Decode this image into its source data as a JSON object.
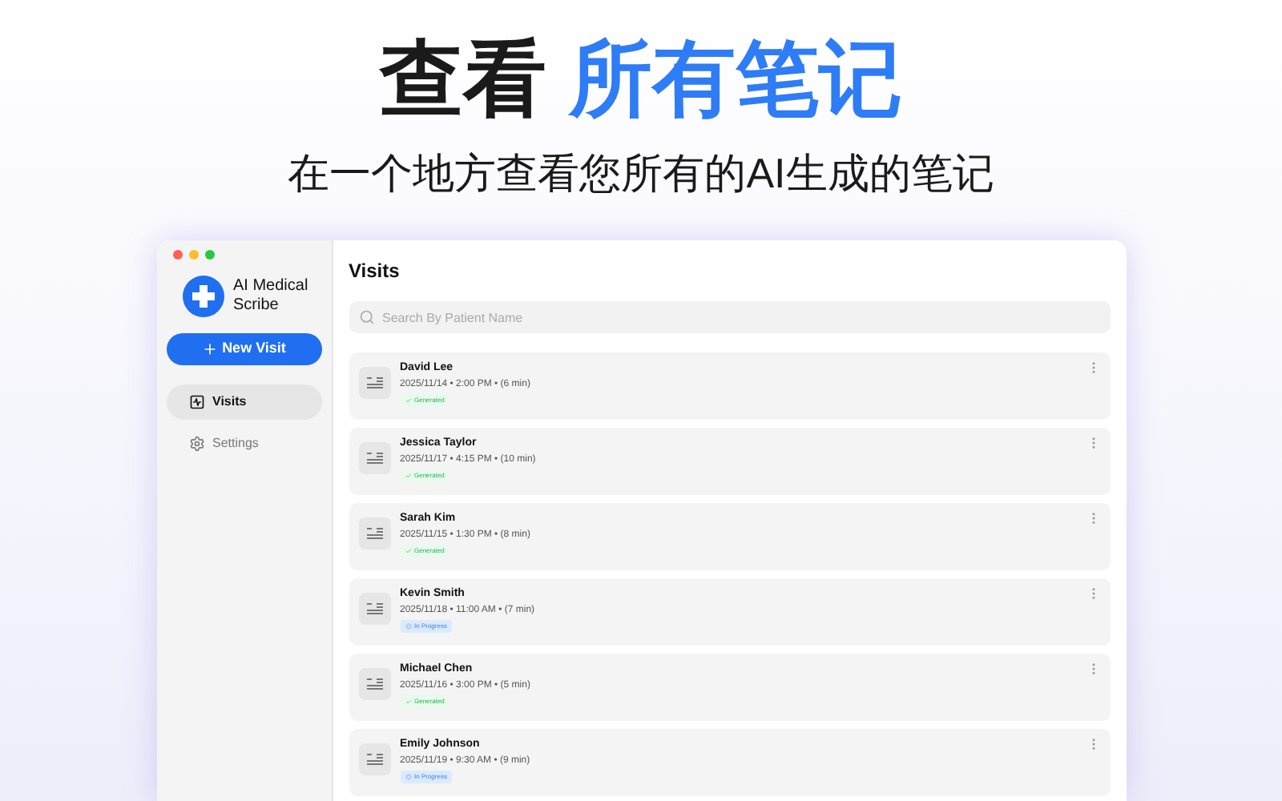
{
  "headline": {
    "plain": "查看",
    "highlight": "所有笔记"
  },
  "subtitle": "在一个地方查看您所有的AI生成的笔记",
  "app": {
    "name_line1": "AI Medical",
    "name_line2": "Scribe",
    "new_visit_button": "New Visit",
    "sidebar": {
      "items": [
        {
          "label": "Visits",
          "kind": "visits",
          "selected": true
        },
        {
          "label": "Settings",
          "kind": "settings",
          "selected": false
        }
      ]
    },
    "page_title": "Visits",
    "search": {
      "placeholder": "Search By Patient Name"
    },
    "visits": [
      {
        "name": "David Lee",
        "details": "2025/11/14 • 2:00 PM • (6 min)",
        "status": "Generated",
        "kind": "generated"
      },
      {
        "name": "Jessica Taylor",
        "details": "2025/11/17 • 4:15 PM • (10 min)",
        "status": "Generated",
        "kind": "generated"
      },
      {
        "name": "Sarah Kim",
        "details": "2025/11/15 • 1:30 PM • (8 min)",
        "status": "Generated",
        "kind": "generated"
      },
      {
        "name": "Kevin Smith",
        "details": "2025/11/18 • 11:00 AM • (7 min)",
        "status": "In Progress",
        "kind": "in_progress"
      },
      {
        "name": "Michael Chen",
        "details": "2025/11/16 • 3:00 PM • (5 min)",
        "status": "Generated",
        "kind": "generated"
      },
      {
        "name": "Emily Johnson",
        "details": "2025/11/19 • 9:30 AM • (9 min)",
        "status": "In Progress",
        "kind": "in_progress"
      }
    ]
  }
}
